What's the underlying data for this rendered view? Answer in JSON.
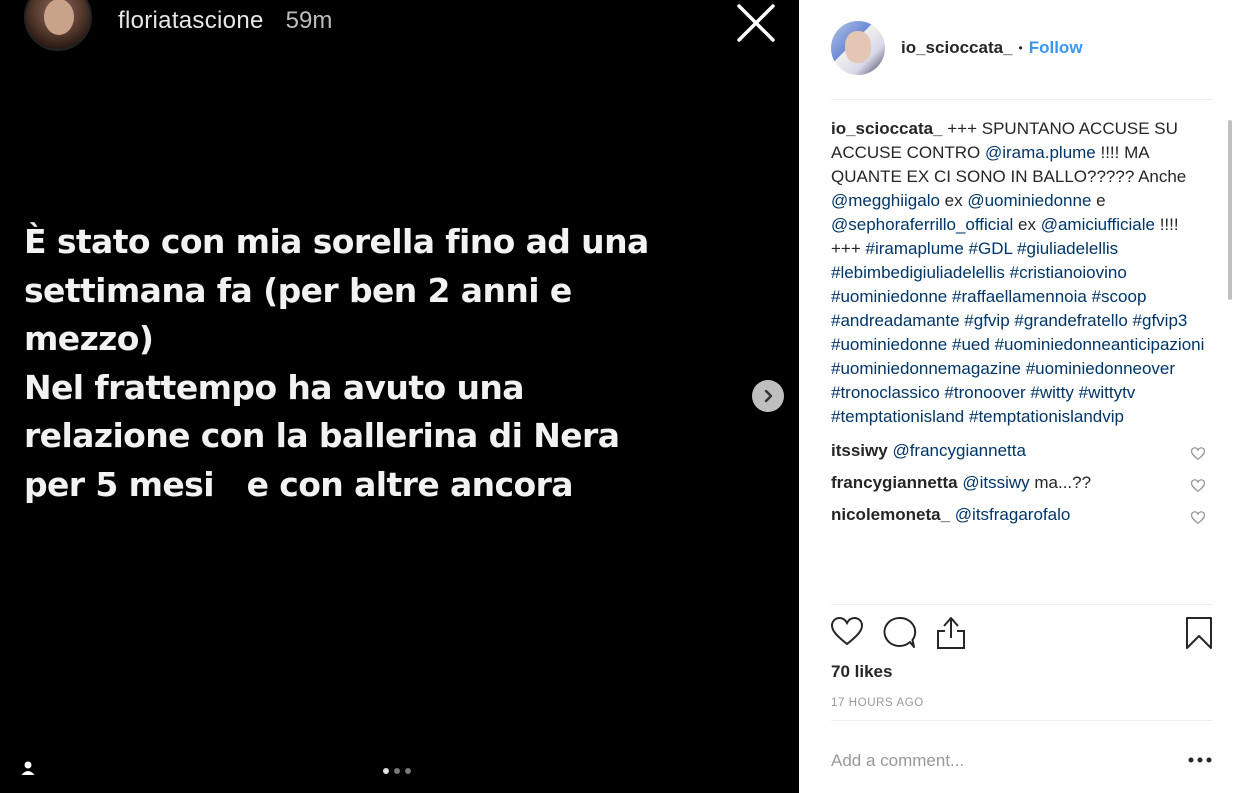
{
  "story": {
    "username": "floriatascione",
    "time": "59m",
    "text_lines": [
      "È stato con mia sorella fino ad una",
      "settimana fa (per ben 2 anni e",
      "mezzo)",
      "Nel frattempo ha avuto una",
      "relazione con la ballerina di Nera",
      "per 5 mesi   e con altre ancora"
    ],
    "carousel": {
      "total": 3,
      "active": 1
    }
  },
  "post": {
    "username": "io_scioccata_",
    "follow_label": "Follow",
    "caption": [
      {
        "t": "user",
        "v": "io_scioccata_"
      },
      {
        "t": "text",
        "v": " +++ SPUNTANO ACCUSE SU ACCUSE CONTRO "
      },
      {
        "t": "link",
        "v": "@irama.plume"
      },
      {
        "t": "text",
        "v": " !!!! MA QUANTE EX CI SONO IN BALLO????? Anche "
      },
      {
        "t": "link",
        "v": "@megghiigalo"
      },
      {
        "t": "text",
        "v": " ex "
      },
      {
        "t": "link",
        "v": "@uominiedonne"
      },
      {
        "t": "text",
        "v": " e "
      },
      {
        "t": "link",
        "v": "@sephoraferrillo_official"
      },
      {
        "t": "text",
        "v": " ex "
      },
      {
        "t": "link",
        "v": "@amiciufficiale"
      },
      {
        "t": "text",
        "v": " !!!! +++ "
      },
      {
        "t": "link",
        "v": "#iramaplume"
      },
      {
        "t": "text",
        "v": " "
      },
      {
        "t": "link",
        "v": "#GDL"
      },
      {
        "t": "text",
        "v": " "
      },
      {
        "t": "link",
        "v": "#giuliadelellis"
      },
      {
        "t": "text",
        "v": " "
      },
      {
        "t": "link",
        "v": "#lebimbedigiuliadelellis"
      },
      {
        "t": "text",
        "v": " "
      },
      {
        "t": "link",
        "v": "#cristianoiovino"
      },
      {
        "t": "text",
        "v": " "
      },
      {
        "t": "link",
        "v": "#uominiedonne"
      },
      {
        "t": "text",
        "v": " "
      },
      {
        "t": "link",
        "v": "#raffaellamennoia"
      },
      {
        "t": "text",
        "v": " "
      },
      {
        "t": "link",
        "v": "#scoop"
      },
      {
        "t": "text",
        "v": " "
      },
      {
        "t": "link",
        "v": "#andreadamante"
      },
      {
        "t": "text",
        "v": " "
      },
      {
        "t": "link",
        "v": "#gfvip"
      },
      {
        "t": "text",
        "v": " "
      },
      {
        "t": "link",
        "v": "#grandefratello"
      },
      {
        "t": "text",
        "v": " "
      },
      {
        "t": "link",
        "v": "#gfvip3"
      },
      {
        "t": "text",
        "v": " "
      },
      {
        "t": "link",
        "v": "#uominiedonne"
      },
      {
        "t": "text",
        "v": " "
      },
      {
        "t": "link",
        "v": "#ued"
      },
      {
        "t": "text",
        "v": " "
      },
      {
        "t": "link",
        "v": "#uominiedonneanticipazioni"
      },
      {
        "t": "text",
        "v": " "
      },
      {
        "t": "link",
        "v": "#uominiedonnemagazine"
      },
      {
        "t": "text",
        "v": " "
      },
      {
        "t": "link",
        "v": "#uominiedonneover"
      },
      {
        "t": "text",
        "v": " "
      },
      {
        "t": "link",
        "v": "#tronoclassico"
      },
      {
        "t": "text",
        "v": " "
      },
      {
        "t": "link",
        "v": "#tronoover"
      },
      {
        "t": "text",
        "v": " "
      },
      {
        "t": "link",
        "v": "#witty"
      },
      {
        "t": "text",
        "v": " "
      },
      {
        "t": "link",
        "v": "#wittytv"
      },
      {
        "t": "text",
        "v": " "
      },
      {
        "t": "link",
        "v": "#temptationisland"
      },
      {
        "t": "text",
        "v": " "
      },
      {
        "t": "link",
        "v": "#temptationislandvip"
      }
    ],
    "comments": [
      {
        "user": "itssiwy",
        "text": " ",
        "mention": "@francygiannetta",
        "rest": ""
      },
      {
        "user": "francygiannetta",
        "text": " ",
        "mention": "@itssiwy",
        "rest": " ma...??"
      },
      {
        "user": "nicolemoneta_",
        "text": " ",
        "mention": "@itsfragarofalo",
        "rest": ""
      }
    ],
    "likes": "70 likes",
    "time_ago": "17 HOURS AGO",
    "comment_placeholder": "Add a comment...",
    "icons": [
      "heart-icon",
      "comment-icon",
      "share-icon",
      "bookmark-icon",
      "more-icon"
    ]
  },
  "colors": {
    "link": "#003569",
    "follow": "#3897f0",
    "muted": "#999999"
  }
}
